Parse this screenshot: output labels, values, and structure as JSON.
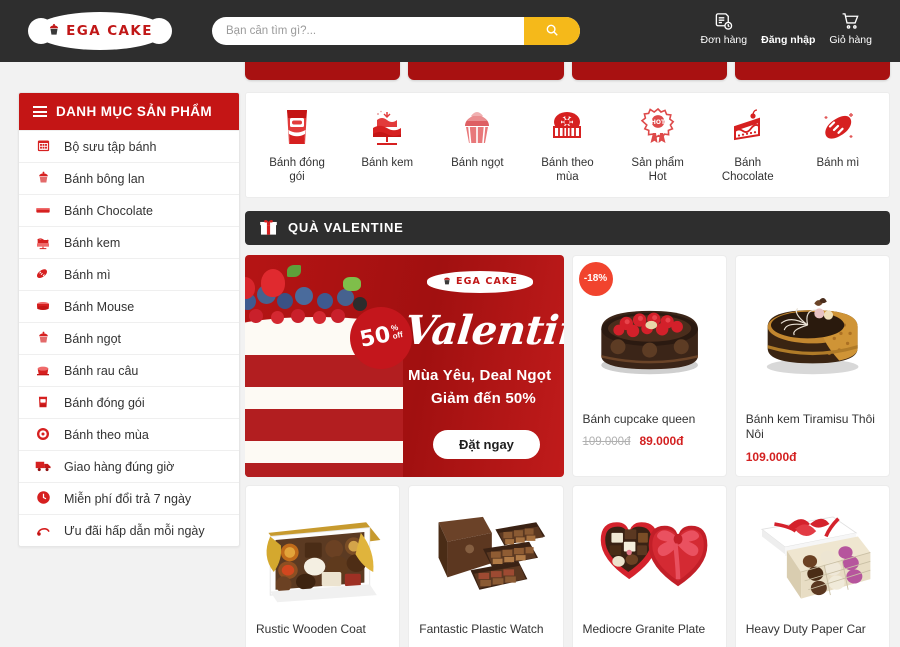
{
  "header": {
    "logo": {
      "text": "EGA CAKE",
      "icon": "cupcake-icon"
    },
    "search": {
      "value": "",
      "placeholder": "Bạn cần tìm gì?...",
      "button_icon": "search-icon"
    },
    "actions": [
      {
        "label": "Đơn hàng",
        "icon": "order-list-icon"
      },
      {
        "label": "Đăng nhập",
        "icon": "login-icon"
      },
      {
        "label": "Giỏ hàng",
        "icon": "cart-icon"
      }
    ]
  },
  "sidebar": {
    "title": "DANH MỤC SẢN PHẨM",
    "menu_icon": "hamburger-icon",
    "items": [
      {
        "label": "Bộ sưu tập bánh",
        "icon": "cake-collection-icon"
      },
      {
        "label": "Bánh bông lan",
        "icon": "sponge-cake-icon"
      },
      {
        "label": "Bánh Chocolate",
        "icon": "chocolate-cake-icon"
      },
      {
        "label": "Bánh kem",
        "icon": "cream-cake-icon"
      },
      {
        "label": "Bánh mì",
        "icon": "bread-icon"
      },
      {
        "label": "Bánh Mouse",
        "icon": "mousse-cake-icon"
      },
      {
        "label": "Bánh ngọt",
        "icon": "sweet-cake-icon"
      },
      {
        "label": "Bánh rau câu",
        "icon": "jelly-cake-icon"
      },
      {
        "label": "Bánh đóng gói",
        "icon": "packaged-cake-icon"
      },
      {
        "label": "Bánh theo mùa",
        "icon": "seasonal-cake-icon"
      },
      {
        "label": "Giao hàng đúng giờ",
        "icon": "delivery-truck-icon"
      },
      {
        "label": "Miễn phí đổi trả 7 ngày",
        "icon": "return-policy-icon"
      },
      {
        "label": "Ưu đãi hấp dẫn mỗi ngày",
        "icon": "daily-deal-icon"
      }
    ]
  },
  "categories": [
    {
      "label": "Bánh đóng gói",
      "icon": "packaged-cake-icon"
    },
    {
      "label": "Bánh kem",
      "icon": "cream-cake-icon"
    },
    {
      "label": "Bánh ngọt",
      "icon": "cupcake-icon"
    },
    {
      "label": "Bánh theo mùa",
      "icon": "mooncake-icon"
    },
    {
      "label": "Sản phẩm Hot",
      "icon": "hot-badge-icon"
    },
    {
      "label": "Bánh Chocolate",
      "icon": "cake-slice-icon"
    },
    {
      "label": "Bánh mì",
      "icon": "baguette-icon"
    }
  ],
  "section": {
    "title": "QUÀ VALENTINE",
    "icon": "gift-icon"
  },
  "banner": {
    "logo_text": "EGA CAKE",
    "title": "Valentine",
    "subtitle_line1": "Mùa Yêu, Deal Ngọt",
    "subtitle_line2": "Giảm đến 50%",
    "cta": "Đặt ngay",
    "badge_number": "50",
    "badge_off_line1": "%",
    "badge_off_line2": "off"
  },
  "products_row1": [
    {
      "name": "Bánh cupcake queen",
      "old_price": "109.000đ",
      "price": "89.000đ",
      "discount": "-18%",
      "image": "chocolate-berry-cake"
    },
    {
      "name": "Bánh kem Tiramisu Thôi Nôi",
      "old_price": "",
      "price": "109.000đ",
      "discount": "",
      "image": "tiramisu-cake"
    }
  ],
  "products_row2": [
    {
      "name": "Rustic Wooden Coat",
      "image": "chocolate-box-gold"
    },
    {
      "name": "Fantastic Plastic Watch",
      "image": "chocolate-trays-dark"
    },
    {
      "name": "Mediocre Granite Plate",
      "image": "heart-chocolate-box"
    },
    {
      "name": "Heavy Duty Paper Car",
      "image": "white-heart-chocolate-box"
    }
  ],
  "colors": {
    "brand_red": "#c41515",
    "header_dark": "#2e2e2e",
    "accent_yellow": "#f5b91a",
    "price_red": "#d32121",
    "discount_red": "#f1442e"
  }
}
